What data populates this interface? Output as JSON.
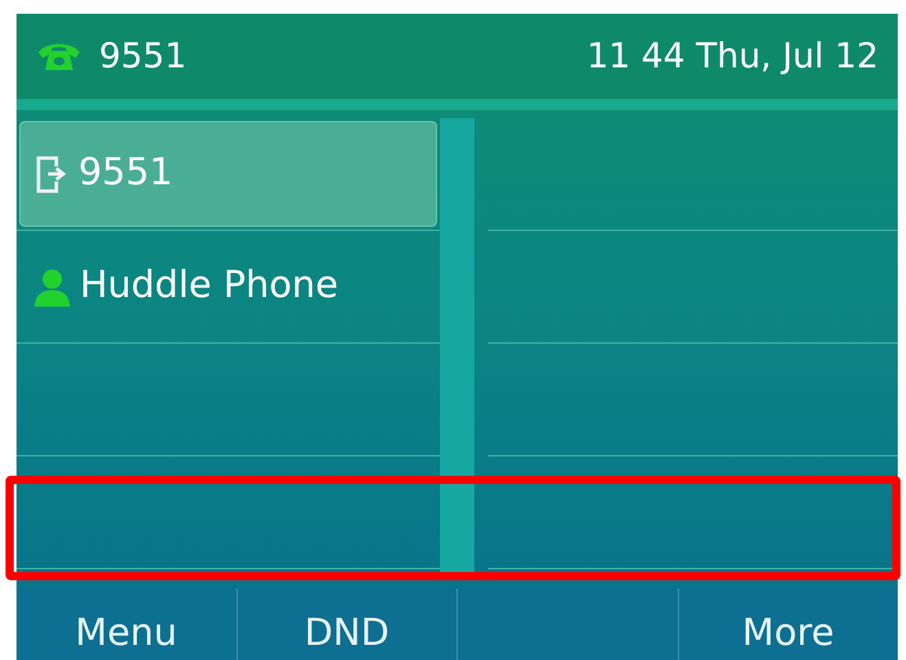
{
  "status_bar": {
    "account": "9551",
    "datetime": "11 44 Thu, Jul 12"
  },
  "line_keys": [
    {
      "kind": "line",
      "label": "9551",
      "selected": true
    },
    {
      "kind": "contact",
      "label": "Huddle Phone",
      "selected": false
    }
  ],
  "highlight_box": true,
  "softkeys": [
    {
      "kind": "key",
      "label": "Menu"
    },
    {
      "kind": "key",
      "label": "DND"
    },
    {
      "kind": "blank"
    },
    {
      "kind": "key",
      "label": "More"
    }
  ]
}
